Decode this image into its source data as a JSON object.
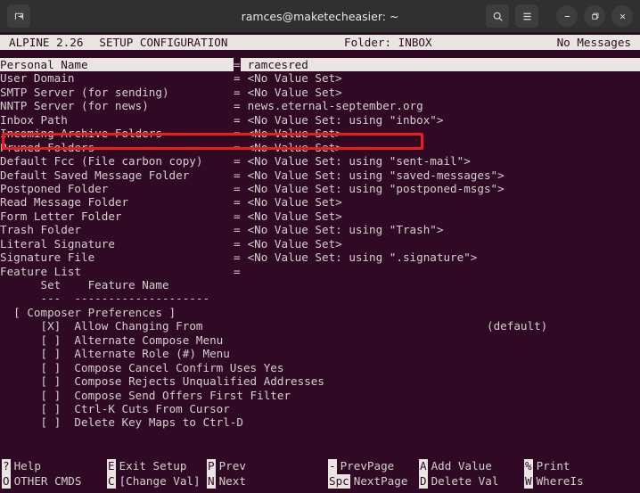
{
  "window": {
    "title": "ramces@maketecheasier: ~",
    "new_tab_icon": "new-tab-icon",
    "search_icon": "search-icon",
    "menu_icon": "hamburger-menu-icon",
    "minimize_icon": "minimize-icon",
    "maximize_icon": "maximize-icon",
    "close_icon": "close-icon"
  },
  "statusline": {
    "app": "ALPINE 2.26",
    "screen": "SETUP CONFIGURATION",
    "folder": "Folder: INBOX",
    "messages": "No Messages"
  },
  "config_rows": [
    {
      "label": "Personal Name",
      "eq": "=",
      "value": "ramcesred",
      "selected": true
    },
    {
      "label": "User Domain",
      "eq": "=",
      "value": "<No Value Set>",
      "selected": false
    },
    {
      "label": "SMTP Server (for sending)",
      "eq": "=",
      "value": "<No Value Set>",
      "selected": false
    },
    {
      "label": "NNTP Server (for news)",
      "eq": "=",
      "value": "news.eternal-september.org",
      "selected": false
    },
    {
      "label": "Inbox Path",
      "eq": "=",
      "value": "<No Value Set: using \"inbox\">",
      "selected": false
    },
    {
      "label": "Incoming Archive Folders",
      "eq": "=",
      "value": "<No Value Set>",
      "selected": false
    },
    {
      "label": "Pruned Folders",
      "eq": "=",
      "value": "<No Value Set>",
      "selected": false
    },
    {
      "label": "Default Fcc (File carbon copy)",
      "eq": "=",
      "value": "<No Value Set: using \"sent-mail\">",
      "selected": false
    },
    {
      "label": "Default Saved Message Folder",
      "eq": "=",
      "value": "<No Value Set: using \"saved-messages\">",
      "selected": false
    },
    {
      "label": "Postponed Folder",
      "eq": "=",
      "value": "<No Value Set: using \"postponed-msgs\">",
      "selected": false
    },
    {
      "label": "Read Message Folder",
      "eq": "=",
      "value": "<No Value Set>",
      "selected": false
    },
    {
      "label": "Form Letter Folder",
      "eq": "=",
      "value": "<No Value Set>",
      "selected": false
    },
    {
      "label": "Trash Folder",
      "eq": "=",
      "value": "<No Value Set: using \"Trash\">",
      "selected": false
    },
    {
      "label": "Literal Signature",
      "eq": "=",
      "value": "<No Value Set>",
      "selected": false
    },
    {
      "label": "Signature File",
      "eq": "=",
      "value": "<No Value Set: using \".signature\">",
      "selected": false
    },
    {
      "label": "Feature List",
      "eq": "=",
      "value": "",
      "selected": false
    }
  ],
  "feature_list": {
    "header": "      Set    Feature Name",
    "rule": "      ---  --------------------",
    "section": "  [ Composer Preferences ]",
    "items": [
      {
        "box": "[X]",
        "name": "Allow Changing From",
        "note": "(default)"
      },
      {
        "box": "[ ]",
        "name": "Alternate Compose Menu",
        "note": ""
      },
      {
        "box": "[ ]",
        "name": "Alternate Role (#) Menu",
        "note": ""
      },
      {
        "box": "[ ]",
        "name": "Compose Cancel Confirm Uses Yes",
        "note": ""
      },
      {
        "box": "[ ]",
        "name": "Compose Rejects Unqualified Addresses",
        "note": ""
      },
      {
        "box": "[ ]",
        "name": "Compose Send Offers First Filter",
        "note": ""
      },
      {
        "box": "[ ]",
        "name": "Ctrl-K Cuts From Cursor",
        "note": ""
      },
      {
        "box": "[ ]",
        "name": "Delete Key Maps to Ctrl-D",
        "note": ""
      }
    ]
  },
  "helpbar": {
    "top": [
      {
        "key": "?",
        "label": "Help"
      },
      {
        "key": "E",
        "label": "Exit Setup"
      },
      {
        "key": "P",
        "label": "Prev"
      },
      {
        "key": "-",
        "label": "PrevPage"
      },
      {
        "key": "A",
        "label": "Add Value"
      },
      {
        "key": "%",
        "label": "Print"
      }
    ],
    "bottom": [
      {
        "key": "O",
        "label": "OTHER CMDS"
      },
      {
        "key": "C",
        "label": "[Change Val]"
      },
      {
        "key": "N",
        "label": "Next"
      },
      {
        "key": "Spc",
        "label": "NextPage"
      },
      {
        "key": "D",
        "label": "Delete Val"
      },
      {
        "key": "W",
        "label": "WhereIs"
      }
    ]
  },
  "annotation": {
    "highlight_color": "#ef1b1b",
    "target_row": "NNTP Server (for news)"
  }
}
